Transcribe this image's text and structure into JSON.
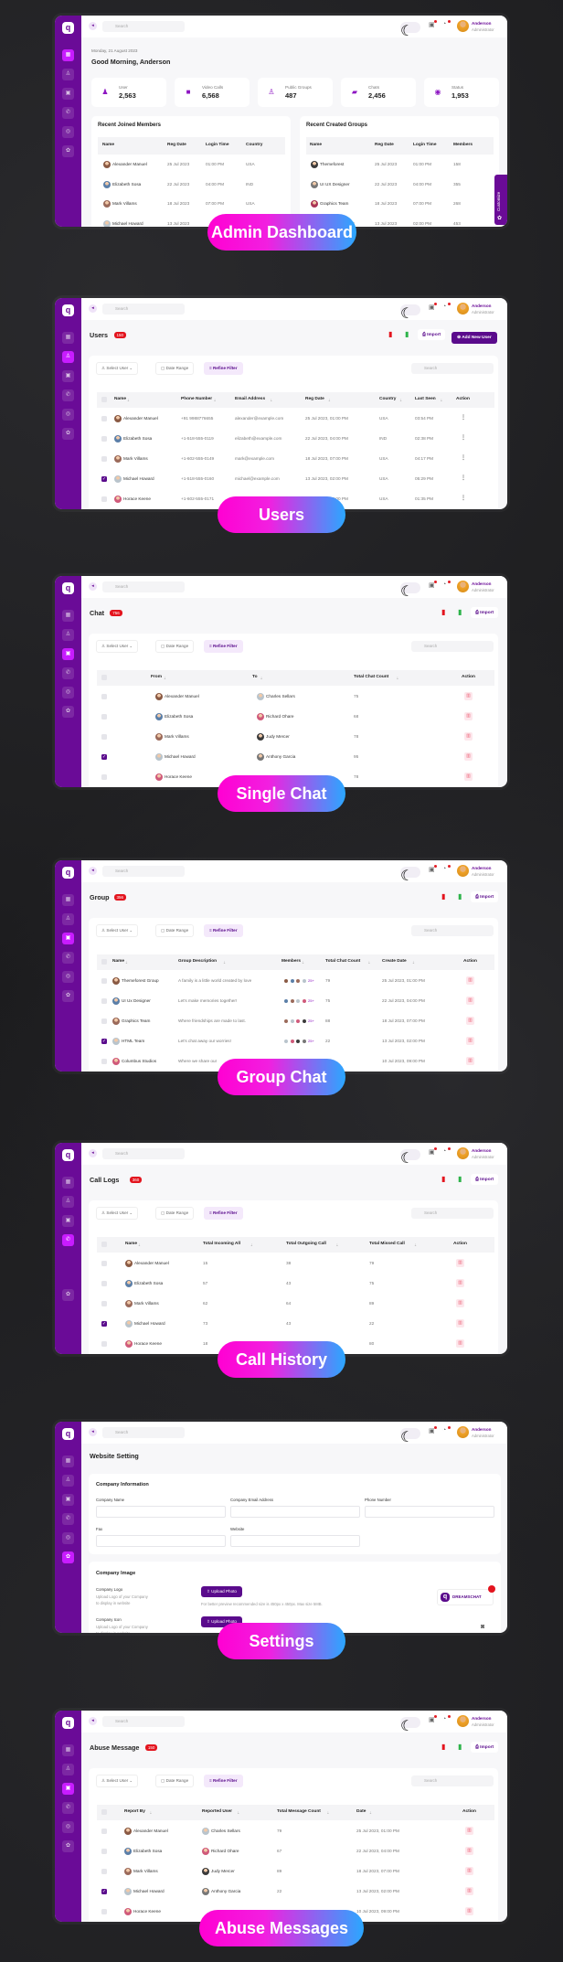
{
  "colors": {
    "sidebar": "#6a0b97",
    "active_nav": "#c81cff",
    "primary": "#5a0b8c",
    "badge": "#e3141e",
    "pill_gradient": [
      "#ff00d2",
      "#2aa7ff"
    ]
  },
  "topbar": {
    "search_placeholder": "Search",
    "user_name": "Anderson",
    "user_role": "Administrator"
  },
  "filters": {
    "select_user": "Select User",
    "date_range": "Date Range",
    "refine_filter": "Refine Filter",
    "search_placeholder": "Search"
  },
  "actions": {
    "import": "Import",
    "add_new_user": "Add New User"
  },
  "labels": [
    "Admin Dashboard",
    "Users",
    "Single Chat",
    "Group Chat",
    "Call History",
    "Settings",
    "Abuse Messages"
  ],
  "dashboard": {
    "date": "Monday, 21 August 2023",
    "greeting": "Good Morning, Anderson",
    "stats": [
      {
        "label": "User",
        "value": "2,563",
        "icon": "user-icon"
      },
      {
        "label": "Video Calls",
        "value": "6,568",
        "icon": "video-icon"
      },
      {
        "label": "Public Groups",
        "value": "487",
        "icon": "group-icon"
      },
      {
        "label": "Chats",
        "value": "2,456",
        "icon": "chat-icon"
      },
      {
        "label": "Status",
        "value": "1,953",
        "icon": "status-icon"
      }
    ],
    "customize": "Customize",
    "members": {
      "title": "Recent Joined Members",
      "headers": [
        "Name",
        "Reg Date",
        "Login Time",
        "Country"
      ],
      "rows": [
        [
          "Alexander Manuel",
          "25 Jul 2023",
          "01:00 PM",
          "USA"
        ],
        [
          "Elizabeth Sosa",
          "22 Jul 2023",
          "04:00 PM",
          "IND"
        ],
        [
          "Mark Villams",
          "18 Jul 2023",
          "07:00 PM",
          "USA"
        ],
        [
          "Michael Howard",
          "13 Jul 2023",
          "",
          ""
        ]
      ]
    },
    "groups": {
      "title": "Recent Created Groups",
      "headers": [
        "Name",
        "Reg Date",
        "Login Time",
        "Members"
      ],
      "rows": [
        [
          "Themeforest",
          "25 Jul 2023",
          "01:00 PM",
          "158"
        ],
        [
          "UI UX Designer",
          "22 Jul 2023",
          "04:00 PM",
          "355"
        ],
        [
          "Graphics Team",
          "18 Jul 2023",
          "07:00 PM",
          "268"
        ],
        [
          "Columbus Studios",
          "13 Jul 2023",
          "02:00 PM",
          "453"
        ]
      ]
    }
  },
  "users": {
    "title": "Users",
    "count": "150",
    "headers": [
      "Name",
      "Phone Number",
      "Email Address",
      "Reg Date",
      "Country",
      "Last Seen",
      "Action"
    ],
    "rows": [
      [
        "Alexander Manuel",
        "+91 9988776655",
        "alexander@example.com",
        "25 Jul 2023, 01:00 PM",
        "USA",
        "03:54 PM"
      ],
      [
        "Elizabeth Sosa",
        "+1-518-555-0119",
        "elizabeth@example.com",
        "22 Jul 2023, 04:00 PM",
        "IND",
        "02:38 PM"
      ],
      [
        "Mark Villams",
        "+1-602-555-0149",
        "mark@example.com",
        "18 Jul 2023, 07:00 PM",
        "USA",
        "04:17 PM"
      ],
      [
        "Michael Howard",
        "+1-518-555-0160",
        "michael@example.com",
        "13 Jul 2023, 02:00 PM",
        "USA",
        "05:29 PM"
      ],
      [
        "Horace Keene",
        "+1-602-555-0171",
        "",
        "10 Jul 2023, 09:00 PM",
        "USA",
        "01:35 PM"
      ]
    ],
    "checked": [
      3
    ]
  },
  "chat": {
    "title": "Chat",
    "count": "756",
    "headers": [
      "From",
      "To",
      "Total Chat Count",
      "Action"
    ],
    "rows": [
      [
        "Alexander Manuel",
        "Charles Sellars",
        "75"
      ],
      [
        "Elizabeth Sosa",
        "Richard Ohare",
        "68"
      ],
      [
        "Mark Villams",
        "Judy Mercer",
        "78"
      ],
      [
        "Michael Howard",
        "Anthony Garcia",
        "95"
      ],
      [
        "Horace Keene",
        "",
        "78"
      ]
    ],
    "checked": [
      3
    ]
  },
  "group": {
    "title": "Group",
    "count": "356",
    "headers": [
      "Name",
      "Group Description",
      "Members",
      "Total Chat Count",
      "Create Date",
      "Action"
    ],
    "rows": [
      [
        "Themeforest Group",
        "A family is a little world created by love",
        "25+",
        "79",
        "25 Jul 2023, 01:00 PM"
      ],
      [
        "UI Ux Designer",
        "Let's make memories together!",
        "25+",
        "75",
        "22 Jul 2023, 04:00 PM"
      ],
      [
        "Graphics Team",
        "Where friendships are made to last.",
        "25+",
        "88",
        "18 Jul 2023, 07:00 PM"
      ],
      [
        "HTML Team",
        "Let's chat away our worries!",
        "25+",
        "22",
        "13 Jul 2023, 02:00 PM"
      ],
      [
        "Columbus Studios",
        "Where we share our",
        "",
        "",
        "10 Jul 2023, 09:00 PM"
      ]
    ],
    "checked": [
      3
    ]
  },
  "calls": {
    "title": "Call Logs",
    "count": "360",
    "headers": [
      "Name",
      "Total Incoming All",
      "Total Outgoing Call",
      "Total Missed Call",
      "Action"
    ],
    "rows": [
      [
        "Alexander Manuel",
        "15",
        "38",
        "79"
      ],
      [
        "Elizabeth Sosa",
        "57",
        "43",
        "75"
      ],
      [
        "Mark Villams",
        "62",
        "64",
        "89"
      ],
      [
        "Michael Howard",
        "73",
        "43",
        "22"
      ],
      [
        "Horace Keene",
        "18",
        "",
        "80"
      ]
    ],
    "checked": [
      3
    ]
  },
  "settings": {
    "title": "Website Setting",
    "info_title": "Company Information",
    "fields": [
      "Company Name",
      "Company Email Address",
      "Phone Number",
      "Fax",
      "Website"
    ],
    "image_title": "Company Image",
    "logo_label": "Company Logo",
    "logo_desc": [
      "Upload Logo of your Company",
      "to display in website"
    ],
    "icon_label": "Company Icon",
    "icon_desc": [
      "Upload Logo of your Company",
      "to display in website"
    ],
    "upload": "Upload Photo",
    "note": "For better preview recommended size is 450px x 450px. Max size 5MB.",
    "brand": "DREAMSCHAT"
  },
  "abuse": {
    "title": "Abuse Message",
    "count": "150",
    "headers": [
      "Report By",
      "Reported User",
      "Total Message Count",
      "Date",
      "Action"
    ],
    "rows": [
      [
        "Alexander Manuel",
        "Charles Sellars",
        "79",
        "25 Jul 2023, 01:00 PM"
      ],
      [
        "Elizabeth Sosa",
        "Richard Ohare",
        "67",
        "22 Jul 2023, 04:00 PM"
      ],
      [
        "Mark Villams",
        "Judy Mercer",
        "89",
        "18 Jul 2023, 07:00 PM"
      ],
      [
        "Michael Howard",
        "Anthony Garcia",
        "22",
        "13 Jul 2023, 02:00 PM"
      ],
      [
        "Horace Keene",
        "",
        "",
        "10 Jul 2023, 09:00 PM"
      ]
    ],
    "checked": [
      3
    ]
  }
}
